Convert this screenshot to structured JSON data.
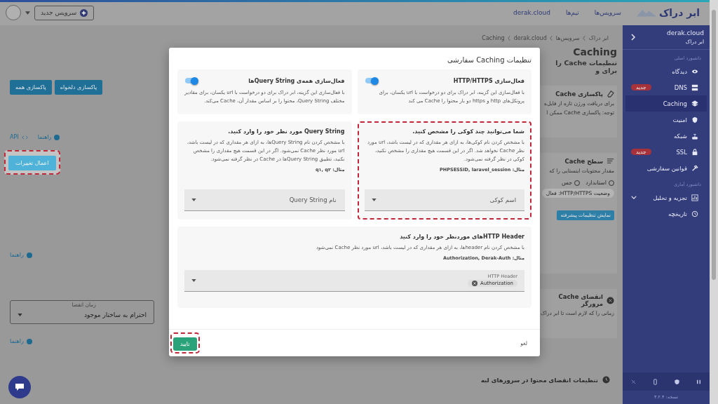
{
  "header": {
    "new_service_button": "سرویس جدید",
    "logo": "ابر دراک",
    "nav": [
      "سرویس‌ها",
      "تیم‌ها",
      "derak.cloud"
    ]
  },
  "sidebar": {
    "domain": "derak.cloud",
    "subtitle": "ابر دراک",
    "sections": [
      {
        "title": "داشبورد اصلی",
        "items": [
          {
            "label": "دیدگاه",
            "selected": false
          },
          {
            "label": "DNS",
            "selected": false,
            "badge": "جدید"
          },
          {
            "label": "Caching",
            "selected": true
          },
          {
            "label": "امنیت",
            "selected": false
          },
          {
            "label": "شبکه",
            "selected": false
          },
          {
            "label": "SSL",
            "selected": false,
            "badge": "جدید"
          },
          {
            "label": "قوانین سفارشی",
            "selected": false
          }
        ]
      },
      {
        "title": "داشبورد آماری",
        "items": [
          {
            "label": "تجزیه و تحلیل",
            "selected": false,
            "expanded": false
          },
          {
            "label": "تاریخچه",
            "selected": false
          }
        ]
      }
    ],
    "version": "نسخه: ۳.۲.۴"
  },
  "breadcrumb": [
    "ابر دراک",
    "سرویس‌ها",
    "derak.cloud",
    "Caching"
  ],
  "page": {
    "title": "Caching",
    "subtitle": "تنظیمات Cache را برای و",
    "purge_card": {
      "title": "پاکسازی Cache",
      "lines": [
        "برای دریافت ورژن تازه از فایل‌ه",
        "توجه: پاکسازی Cache ممکن ا"
      ],
      "buttons": [
        "پاکسازی دلخواه",
        "پاکسازی همه"
      ],
      "links": [
        "راهنما",
        "API"
      ]
    },
    "apply_button": {
      "label": "اعمال تغییرات",
      "highlighted": true
    },
    "level_card": {
      "title": "سطح Cache",
      "text": "مقدار محتویات اینستایی را که",
      "options": [
        {
          "label": "استاندارد",
          "selected": false
        },
        {
          "label": "جس",
          "selected": false
        }
      ],
      "status": "وضعیت HTTP/HTTPS: فعال",
      "advanced_button": "نمایش تنظیمات پیشرفته",
      "help": "راهنما"
    },
    "browser_card": {
      "title": "انقضای Cache مرورگر",
      "text": "زمانی را که لازم است تا ابر دراک",
      "select_label": "زمان انقضا",
      "select_value": "احترام به ساختار موجود",
      "help": "راهنما"
    },
    "edge_card": {
      "title": "تنظیمات انقضای محتوا در سرورهای لبه"
    }
  },
  "modal": {
    "title": "تنظیمات Caching سفارشی",
    "toggles": [
      {
        "title": "فعال‌سازی HTTP/HTTPS",
        "on": true,
        "description": "با فعال‌سازی این گزینه، ابر دراک برای دو درخواست با url یکسان، برای پروتکل‌های http و https دو بار محتوا را Cache می کند"
      },
      {
        "title": "فعال‌سازی همه‌ی Query Stringها",
        "on": true,
        "description": "با فعال‌سازی این گزینه، ابر دراک برای دو درخواست با url یکسان، برای مقادیر مختلف Query String، محتوا را بر اساس مقدار آن، Cache می‌کند."
      }
    ],
    "inputs": [
      {
        "title": "شما می‌توانید چند کوکی را مشخص کنید.",
        "highlighted": true,
        "description": "با مشخص کردن نام کوکی‌ها، به ازای هر مقداری که در لیست باشد، url مورد نظر Cache نخواهد شد. اگر در این قسمت هیچ مقداری را مشخص نکنید، کوکی در نظر گرفته نمی‌شود.",
        "example": "مثال: PHPSESSID, laravel_session",
        "placeholder": "اسم کوکی"
      },
      {
        "title": "Query String مورد نظر خود را وارد کنید.",
        "highlighted": false,
        "description": "با مشخص کردن نام Query Stringها، به ازای هر مقداری که در لیست باشد، url مورد نظر Cache نمی‌شود. اگر در این قسمت هیچ مقداری را مشخص نکنید، تطبیق Query Stringها در Cache در نظر گرفته نمی‌شود.",
        "example": "مثال: q۱, q۲",
        "placeholder": "نام Query String"
      }
    ],
    "header_input": {
      "title": "HTTP Headerهای موردنظر خود را وارد کنید",
      "description": "با مشخص کردن نام headerها، به ازای هر مقداری که در لیست باشد، url مورد نظر Cache نمی‌شود",
      "example": "مثال: Authorization, Derak-Auth",
      "label": "HTTP Header",
      "chips": [
        "Authorization"
      ]
    },
    "confirm_button": {
      "label": "تایید",
      "highlighted": true
    },
    "cancel_button": "لغو"
  }
}
